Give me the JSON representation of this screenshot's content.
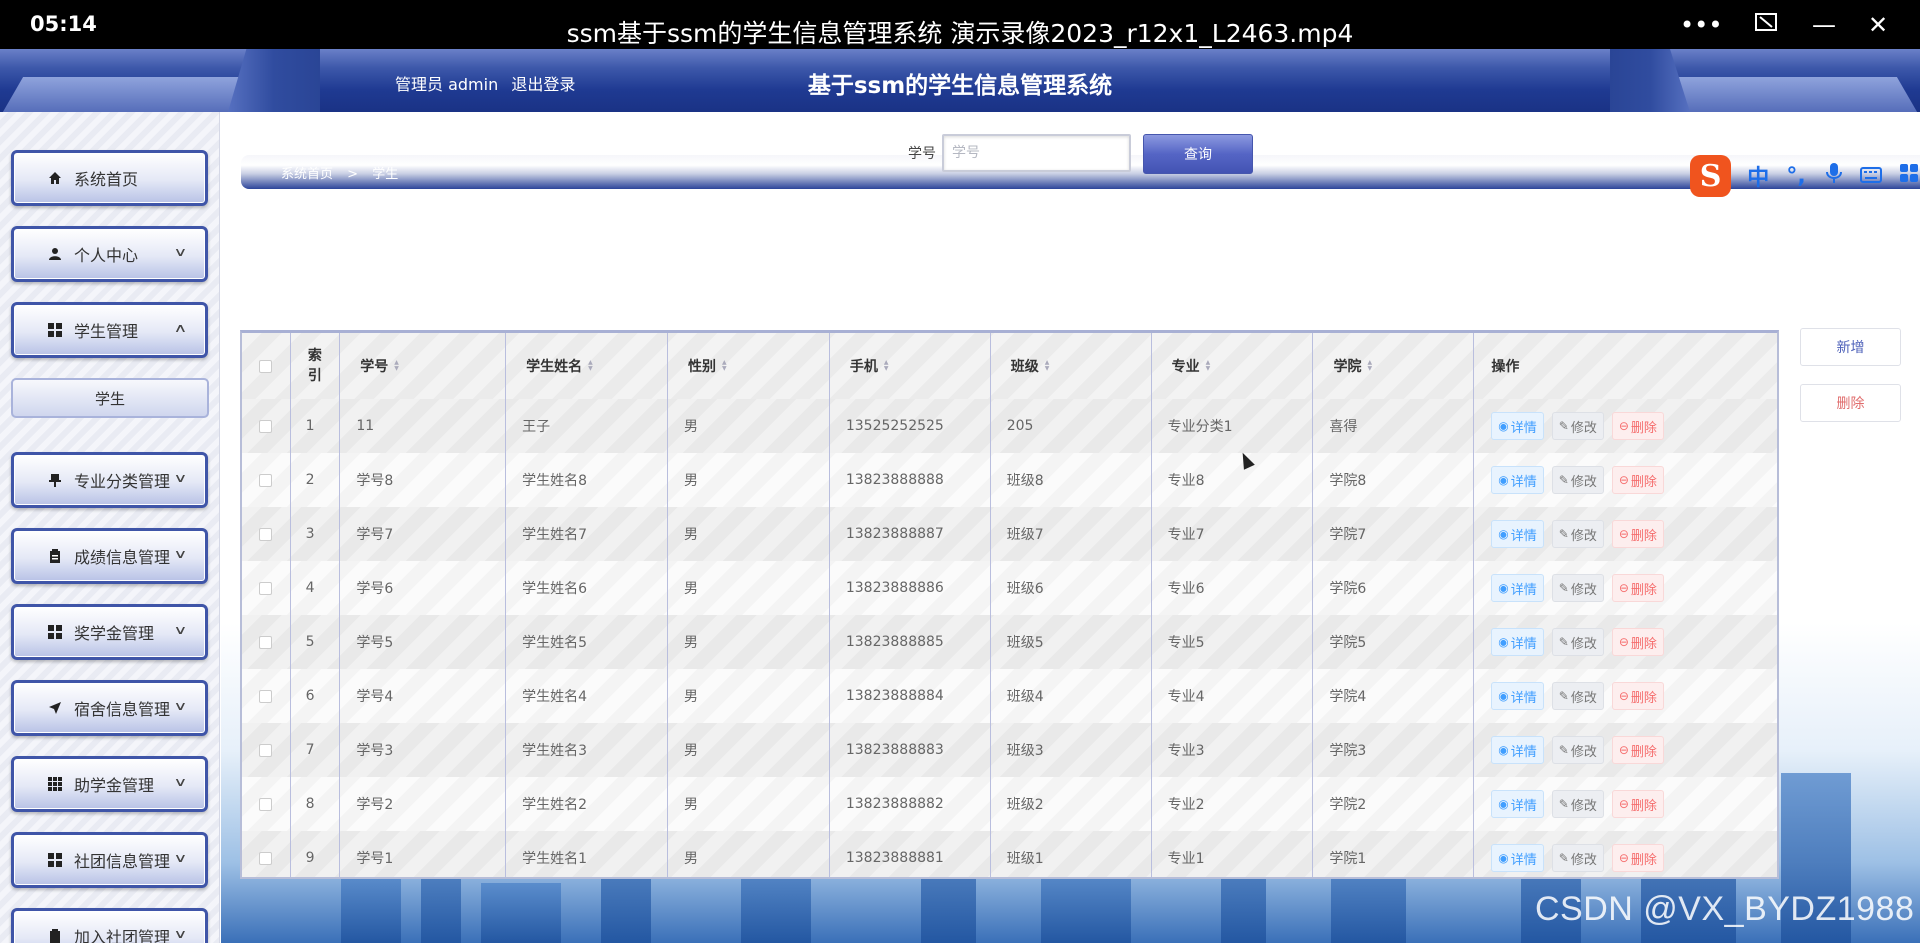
{
  "player": {
    "time": "05:14",
    "title": "ssm基于ssm的学生信息管理系统 演示录像2023_r12x1_L2463.mp4",
    "controls": [
      "more-icon",
      "pip-icon",
      "minimize-icon",
      "close-icon"
    ]
  },
  "header": {
    "role": "管理员 admin",
    "logout": "退出登录",
    "title": "基于ssm的学生信息管理系统"
  },
  "sidebar": {
    "items": [
      {
        "label": "系统首页",
        "icon": "home-icon"
      },
      {
        "label": "个人中心",
        "icon": "user-icon"
      },
      {
        "label": "学生管理",
        "icon": "grid-icon"
      },
      {
        "label": "学生",
        "sub": true
      },
      {
        "label": "专业分类管理",
        "icon": "pin-icon"
      },
      {
        "label": "成绩信息管理",
        "icon": "clipboard-icon"
      },
      {
        "label": "奖学金管理",
        "icon": "grid-icon"
      },
      {
        "label": "宿舍信息管理",
        "icon": "send-icon"
      },
      {
        "label": "助学金管理",
        "icon": "apps-icon"
      },
      {
        "label": "社团信息管理",
        "icon": "grid-icon"
      },
      {
        "label": "加入社团管理",
        "icon": "clipboard-icon"
      }
    ]
  },
  "search": {
    "label": "学号",
    "placeholder": "学号",
    "button": "查询"
  },
  "breadcrumb": [
    "系统首页",
    ">",
    "学生"
  ],
  "actions": {
    "add": "新增",
    "delete": "删除"
  },
  "table": {
    "index_header": [
      "索",
      "引"
    ],
    "columns": [
      "学号",
      "学生姓名",
      "性别",
      "手机",
      "班级",
      "专业",
      "学院",
      "操作"
    ],
    "ops": {
      "view": "详情",
      "edit": "修改",
      "del": "删除"
    },
    "rows": [
      {
        "idx": "1",
        "xuehao": "11",
        "name": "王子",
        "sex": "男",
        "phone": "13525252525",
        "cls": "205",
        "major": "专业分类1",
        "college": "喜得"
      },
      {
        "idx": "2",
        "xuehao": "学号8",
        "name": "学生姓名8",
        "sex": "男",
        "phone": "13823888888",
        "cls": "班级8",
        "major": "专业8",
        "college": "学院8"
      },
      {
        "idx": "3",
        "xuehao": "学号7",
        "name": "学生姓名7",
        "sex": "男",
        "phone": "13823888887",
        "cls": "班级7",
        "major": "专业7",
        "college": "学院7"
      },
      {
        "idx": "4",
        "xuehao": "学号6",
        "name": "学生姓名6",
        "sex": "男",
        "phone": "13823888886",
        "cls": "班级6",
        "major": "专业6",
        "college": "学院6"
      },
      {
        "idx": "5",
        "xuehao": "学号5",
        "name": "学生姓名5",
        "sex": "男",
        "phone": "13823888885",
        "cls": "班级5",
        "major": "专业5",
        "college": "学院5"
      },
      {
        "idx": "6",
        "xuehao": "学号4",
        "name": "学生姓名4",
        "sex": "男",
        "phone": "13823888884",
        "cls": "班级4",
        "major": "专业4",
        "college": "学院4"
      },
      {
        "idx": "7",
        "xuehao": "学号3",
        "name": "学生姓名3",
        "sex": "男",
        "phone": "13823888883",
        "cls": "班级3",
        "major": "专业3",
        "college": "学院3"
      },
      {
        "idx": "8",
        "xuehao": "学号2",
        "name": "学生姓名2",
        "sex": "男",
        "phone": "13823888882",
        "cls": "班级2",
        "major": "专业2",
        "college": "学院2"
      },
      {
        "idx": "9",
        "xuehao": "学号1",
        "name": "学生姓名1",
        "sex": "男",
        "phone": "13823888881",
        "cls": "班级1",
        "major": "专业1",
        "college": "学院1"
      }
    ]
  },
  "ime": {
    "logo": "S",
    "lang": "中",
    "punct": "°,"
  },
  "watermark": "CSDN @VX_BYDZ1988",
  "colors": {
    "header_blue": "#1f3a92",
    "query_button": "#5565c5",
    "view": "#409eff",
    "delete": "#f56c6c",
    "ime_orange": "#f0541e"
  }
}
